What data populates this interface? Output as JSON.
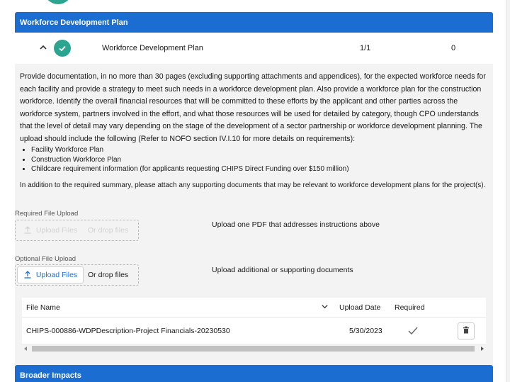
{
  "sections": {
    "workforce_title": "Workforce Development Plan",
    "broader_title": "Broader Impacts"
  },
  "item": {
    "title": "Workforce Development Plan",
    "count": "1/1",
    "zero": "0"
  },
  "description": {
    "paragraph": "Provide documentation, in no more than 30 pages (excluding supporting attachments and appendices), for the expected workforce needs for each facility and provide a strategy to meet such needs in a workforce development plan. Also provide a workforce plan for the construction workforce. Identify the overall financial resources that will be committed to these efforts by the applicant and other parties across the workforce system, partners involved in the effort, and what those resources will be used for detailed by category, though CPO understands that the level of detail may vary depending on the stage of the development of a sector partnership or workforce development planning. The upload should include the following (Refer to NOFO section IV.I.10 for more details on requirements):",
    "bullets": [
      "Facility Workforce Plan",
      "Construction Workforce Plan",
      "Childcare requirement information (for applicants requesting CHIPS Direct Funding over $150 million)"
    ],
    "note": "In addition to the required summary, please attach any supporting documents that may be relevant to workforce development plans for the project(s)."
  },
  "required_upload": {
    "label": "Required File Upload",
    "button": "Upload Files",
    "drop": "Or drop files",
    "description": "Upload one PDF that addresses instructions above"
  },
  "optional_upload": {
    "label": "Optional File Upload",
    "button": "Upload Files",
    "drop": "Or drop files",
    "description": "Upload additional or supporting documents"
  },
  "table": {
    "headers": {
      "file_name": "File Name",
      "upload_date": "Upload Date",
      "required": "Required"
    },
    "rows": [
      {
        "file_name": "CHIPS-000886-WDPDescription-Project Financials-20230530",
        "upload_date": "5/30/2023",
        "required": true
      }
    ]
  },
  "colors": {
    "primary": "#1b6dd1",
    "success": "#2ba58f",
    "panel_bg": "#f3f3f3"
  },
  "icons": [
    "chevron-up-icon",
    "check-icon",
    "upload-icon",
    "chevron-down-icon",
    "checkmark-icon",
    "trash-icon"
  ]
}
